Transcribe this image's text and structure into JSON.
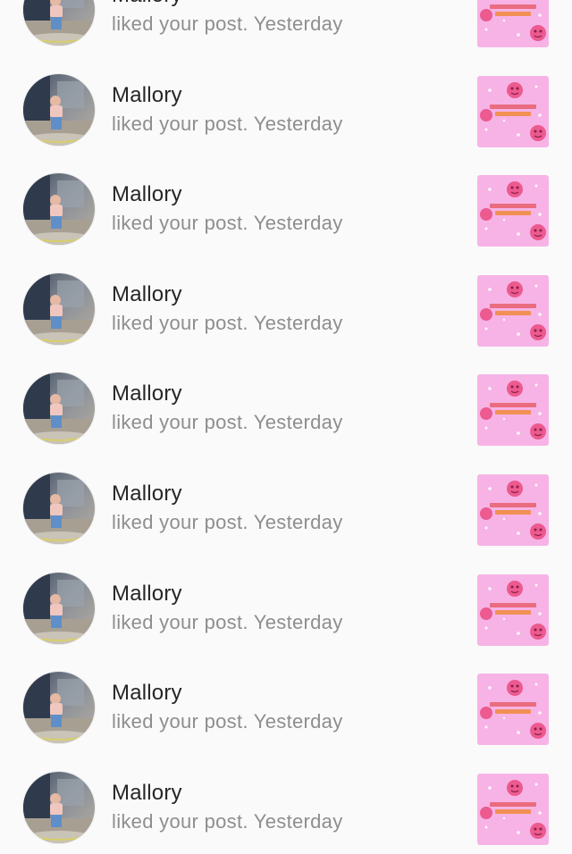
{
  "notifications": [
    {
      "user": "Mallory",
      "action": "liked your post.",
      "time": "Yesterday"
    },
    {
      "user": "Mallory",
      "action": "liked your post.",
      "time": "Yesterday"
    },
    {
      "user": "Mallory",
      "action": "liked your post.",
      "time": "Yesterday"
    },
    {
      "user": "Mallory",
      "action": "liked your post.",
      "time": "Yesterday"
    },
    {
      "user": "Mallory",
      "action": "liked your post.",
      "time": "Yesterday"
    },
    {
      "user": "Mallory",
      "action": "liked your post.",
      "time": "Yesterday"
    },
    {
      "user": "Mallory",
      "action": "liked your post.",
      "time": "Yesterday"
    },
    {
      "user": "Mallory",
      "action": "liked your post.",
      "time": "Yesterday"
    },
    {
      "user": "Mallory",
      "action": "liked your post.",
      "time": "Yesterday"
    }
  ],
  "colors": {
    "background": "#fafafa",
    "name_text": "#262626",
    "secondary_text": "#8e8e8e",
    "thumbnail_pink": "#f7b3e6",
    "thumbnail_accent": "#ec5a8f"
  },
  "icons": {
    "avatar": "profile-photo",
    "thumbnail": "post-thumbnail"
  }
}
